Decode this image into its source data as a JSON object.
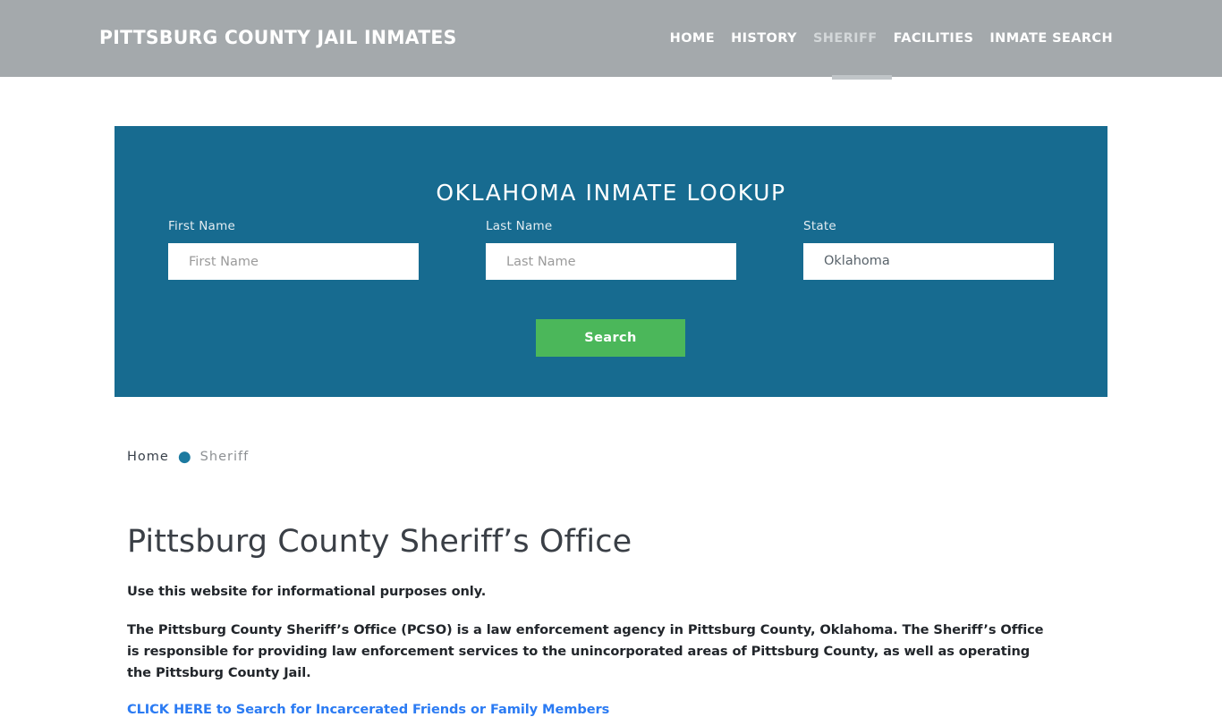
{
  "header": {
    "brand": "Pittsburg County Jail Inmates",
    "nav": [
      {
        "label": "Home",
        "active": false
      },
      {
        "label": "History",
        "active": false
      },
      {
        "label": "Sheriff",
        "active": true
      },
      {
        "label": "Facilities",
        "active": false
      },
      {
        "label": "Inmate Search",
        "active": false
      }
    ],
    "background_color": "#a4a9ac",
    "text_color": "#ffffff",
    "active_color": "#d3d7d9"
  },
  "lookup": {
    "title": "Oklahoma Inmate Lookup",
    "panel_color": "#176b90",
    "first_name": {
      "label": "First Name",
      "placeholder": "First Name",
      "value": ""
    },
    "last_name": {
      "label": "Last Name",
      "placeholder": "Last Name",
      "value": ""
    },
    "state": {
      "label": "State",
      "value": "Oklahoma"
    },
    "search_button": {
      "label": "Search",
      "color": "#4bb75a"
    }
  },
  "breadcrumb": {
    "home": "Home",
    "separator": "●",
    "current": "Sheriff",
    "separator_color": "#1c7aa0"
  },
  "main": {
    "title": "Pittsburg County Sheriff’s Office",
    "paragraph1": "Use this website for informational purposes only.",
    "paragraph2": "The Pittsburg County Sheriff’s Office (PCSO) is a law enforcement agency in Pittsburg County, Oklahoma. The Sheriff’s Office is responsible for providing law enforcement services to the unincorporated areas of Pittsburg County, as well as operating the Pittsburg County Jail.",
    "cta_link": "CLICK HERE to Search for Incarcerated Friends or Family Members",
    "cta_color": "#2b7bf3"
  }
}
